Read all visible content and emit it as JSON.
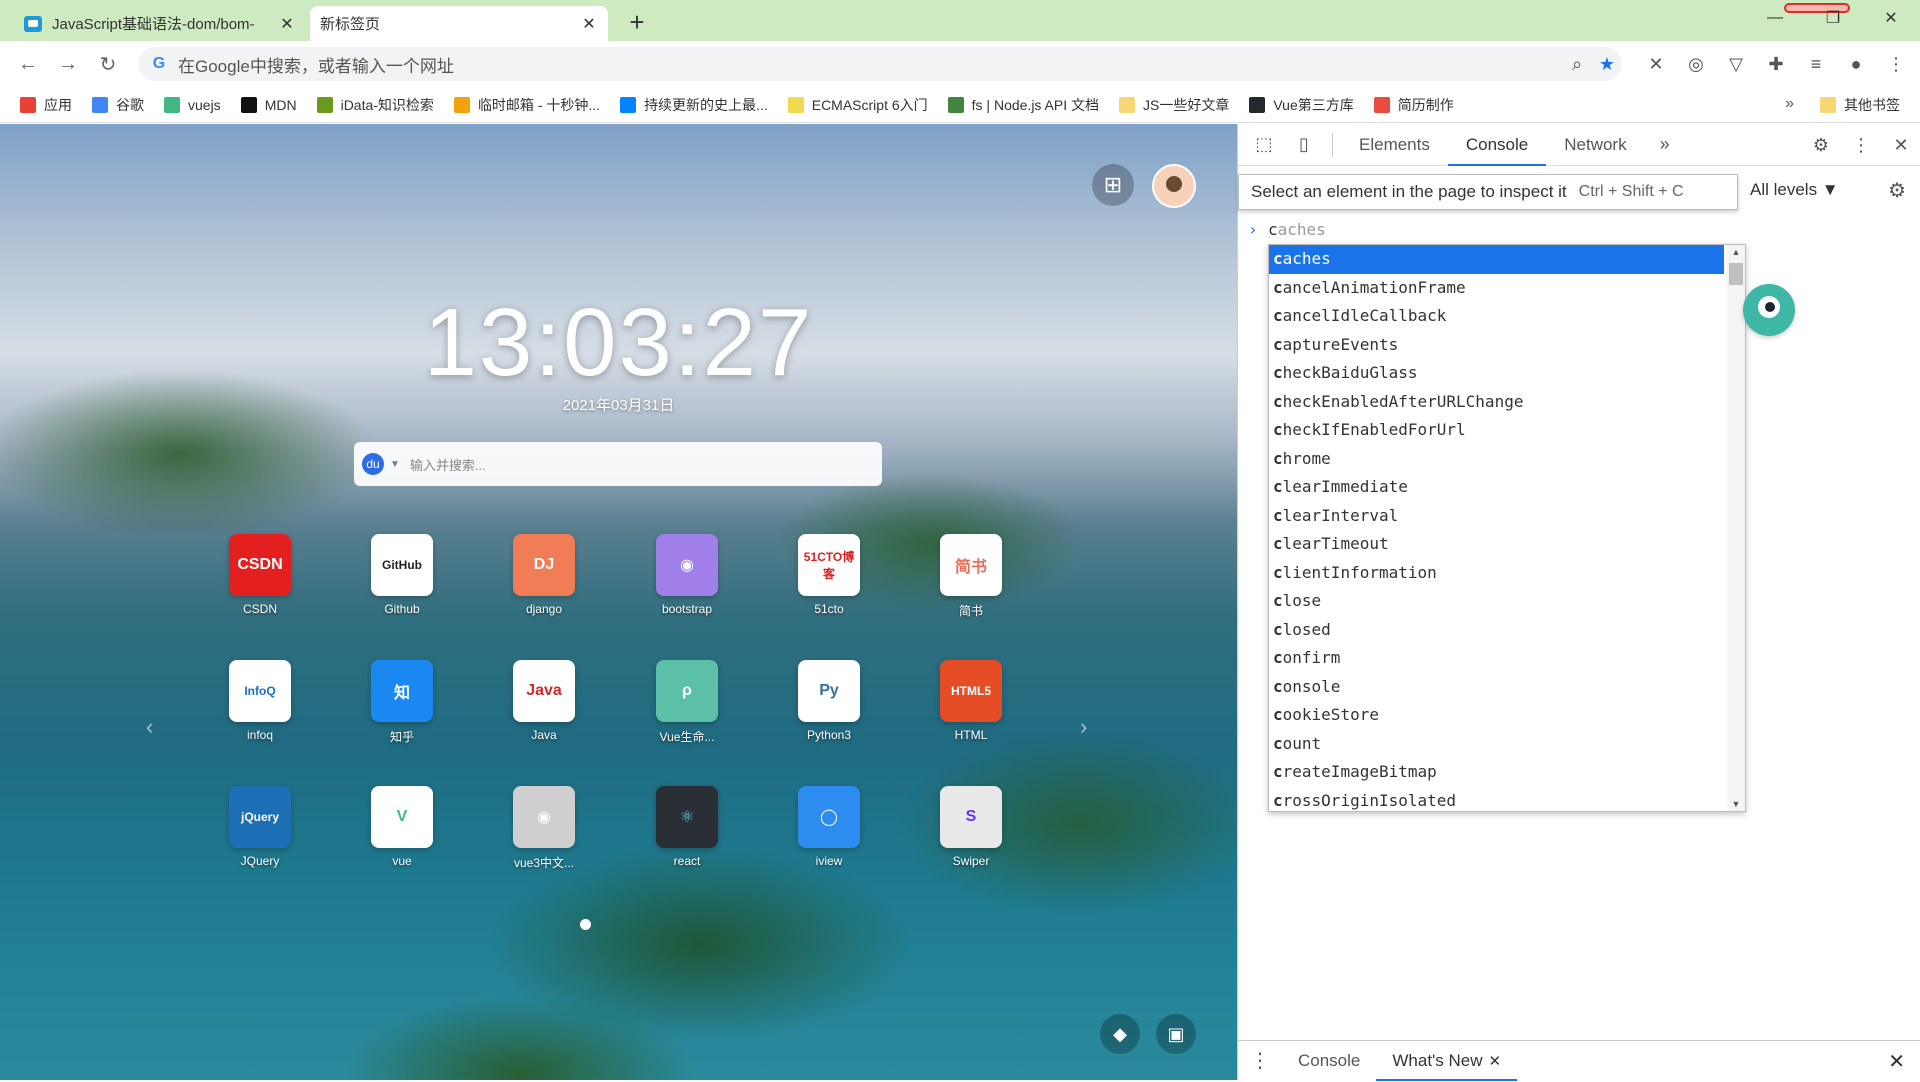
{
  "tabs": [
    {
      "title": "JavaScript基础语法-dom/bom-",
      "close": "✕"
    },
    {
      "title": "新标签页",
      "close": "✕"
    }
  ],
  "new_tab": "+",
  "window_controls": {
    "minimize": "—",
    "restore": "❐",
    "close": "✕"
  },
  "toolbar": {
    "back": "←",
    "forward": "→",
    "reload": "↻",
    "omnibox_g": "G",
    "omnibox_placeholder": "在Google中搜索，或者输入一个网址",
    "zoom_icon": "⌕",
    "star_icon": "★",
    "extensions": [
      "✕",
      "◎",
      "▽",
      "✚",
      "≡",
      "●",
      "⋮"
    ]
  },
  "bookmarks": [
    {
      "label": "应用",
      "color": "#e94235"
    },
    {
      "label": "谷歌",
      "color": "#4285f4"
    },
    {
      "label": "vuejs",
      "color": "#41b883"
    },
    {
      "label": "MDN",
      "color": "#111111"
    },
    {
      "label": "iData-知识检索",
      "color": "#6a9a1f"
    },
    {
      "label": "临时邮箱 - 十秒钟...",
      "color": "#f2a20a"
    },
    {
      "label": "持续更新的史上最...",
      "color": "#0084ff"
    },
    {
      "label": "ECMAScript 6入门",
      "color": "#f0db4f"
    },
    {
      "label": "fs | Node.js API 文档",
      "color": "#43853d"
    },
    {
      "label": "JS一些好文章",
      "color": "#f7d774"
    },
    {
      "label": "Vue第三方库",
      "color": "#24292e"
    },
    {
      "label": "简历制作",
      "color": "#e74c3c"
    }
  ],
  "bookmarks_more": "»",
  "bookmarks_other": "其他书签",
  "newtab": {
    "clock": "13:03:27",
    "date": "2021年03月31日",
    "search_placeholder": "输入并搜索...",
    "search_engine_icon": "du",
    "apps_icon": "⊞",
    "pager_prev": "‹",
    "pager_next": "›",
    "apps": [
      {
        "label": "CSDN",
        "icon_text": "CSDN",
        "bg": "#e31f1f",
        "fg": "#ffffff"
      },
      {
        "label": "Github",
        "icon_text": "GitHub",
        "bg": "#ffffff",
        "fg": "#222222"
      },
      {
        "label": "django",
        "icon_text": "DJ",
        "bg": "#f07d55",
        "fg": "#ffffff"
      },
      {
        "label": "bootstrap",
        "icon_text": "◉",
        "bg": "#a07fe8",
        "fg": "#ffffff"
      },
      {
        "label": "51cto",
        "icon_text": "51CTO博客",
        "bg": "#ffffff",
        "fg": "#d62323"
      },
      {
        "label": "简书",
        "icon_text": "简书",
        "bg": "#ffffff",
        "fg": "#ea6f5a"
      },
      {
        "label": "infoq",
        "icon_text": "InfoQ",
        "bg": "#ffffff",
        "fg": "#1a6fc4"
      },
      {
        "label": "知乎",
        "icon_text": "知",
        "bg": "#1a88f0",
        "fg": "#ffffff"
      },
      {
        "label": "Java",
        "icon_text": "Java",
        "bg": "#ffffff",
        "fg": "#d1282b"
      },
      {
        "label": "Vue生命...",
        "icon_text": "ρ",
        "bg": "#5cbfa7",
        "fg": "#ffffff"
      },
      {
        "label": "Python3",
        "icon_text": "Py",
        "bg": "#ffffff",
        "fg": "#3670a0"
      },
      {
        "label": "HTML",
        "icon_text": "HTML5",
        "bg": "#e44d26",
        "fg": "#ffffff"
      },
      {
        "label": "JQuery",
        "icon_text": "jQuery",
        "bg": "#1c6fb5",
        "fg": "#ffffff"
      },
      {
        "label": "vue",
        "icon_text": "V",
        "bg": "#ffffff",
        "fg": "#41b883"
      },
      {
        "label": "vue3中文...",
        "icon_text": "◉",
        "bg": "#cfcfcf",
        "fg": "#ffffff"
      },
      {
        "label": "react",
        "icon_text": "⚛",
        "bg": "#2a2f35",
        "fg": "#61dafb"
      },
      {
        "label": "iview",
        "icon_text": "◯",
        "bg": "#2d8cf0",
        "fg": "#ffffff"
      },
      {
        "label": "Swiper",
        "icon_text": "S",
        "bg": "#e8e8e8",
        "fg": "#6332f6"
      }
    ],
    "bottom_tools": [
      "◆",
      "▣"
    ]
  },
  "devtools": {
    "inspect_icon": "⬚",
    "device_icon": "▯",
    "tabs": [
      "Elements",
      "Console",
      "Network"
    ],
    "more_tabs": "»",
    "settings_icon": "⚙",
    "menu_icon": "⋮",
    "close_icon": "✕",
    "tooltip": "Select an element in the page to inspect it",
    "tooltip_shortcut": "Ctrl + Shift + C",
    "levels": "All levels ▼",
    "console_settings_icon": "⚙",
    "prompt_chevron": "›",
    "prompt_typed": "c",
    "prompt_ghost": "aches",
    "autocomplete": [
      "caches",
      "cancelAnimationFrame",
      "cancelIdleCallback",
      "captureEvents",
      "checkBaiduGlass",
      "checkEnabledAfterURLChange",
      "checkIfEnabledForUrl",
      "chrome",
      "clearImmediate",
      "clearInterval",
      "clearTimeout",
      "clientInformation",
      "close",
      "closed",
      "confirm",
      "console",
      "cookieStore",
      "count",
      "createImageBitmap",
      "crossOriginIsolated"
    ],
    "scroll_up": "▲",
    "scroll_down": "▼",
    "drawer": {
      "menu": "⋮",
      "tabs": [
        "Console",
        "What's New"
      ],
      "tab_close": "✕",
      "close": "✕"
    }
  }
}
